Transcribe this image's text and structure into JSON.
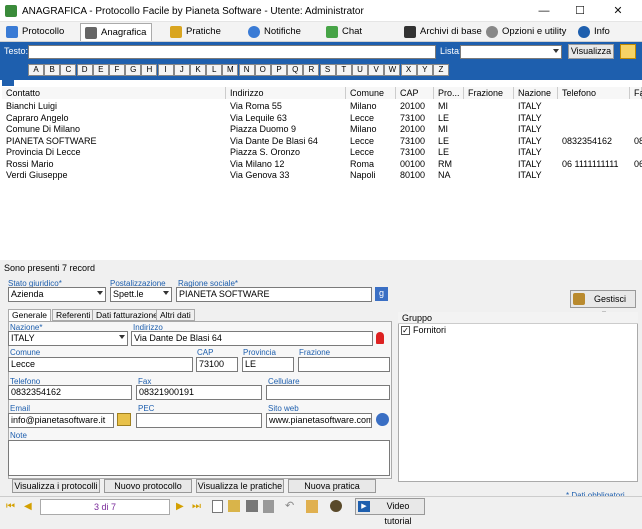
{
  "window": {
    "title": "ANAGRAFICA - Protocollo Facile by Pianeta Software - Utente: Administrator",
    "min": "—",
    "max": "☐",
    "close": "✕"
  },
  "tabs": [
    {
      "label": "Protocollo"
    },
    {
      "label": "Anagrafica"
    },
    {
      "label": "Pratiche"
    },
    {
      "label": "Notifiche"
    },
    {
      "label": "Chat"
    },
    {
      "label": "Archivi di base"
    },
    {
      "label": "Opzioni e utility"
    },
    {
      "label": "Info"
    }
  ],
  "search": {
    "testo_label": "Testo:",
    "testo_value": "",
    "lista_label": "Lista:",
    "lista_value": "",
    "visualizza_label": "Visualizza"
  },
  "letters": [
    "A",
    "B",
    "C",
    "D",
    "E",
    "F",
    "G",
    "H",
    "I",
    "J",
    "K",
    "L",
    "M",
    "N",
    "O",
    "P",
    "Q",
    "R",
    "S",
    "T",
    "U",
    "V",
    "W",
    "X",
    "Y",
    "Z"
  ],
  "grid": {
    "columns": [
      "Contatto",
      "Indirizzo",
      "Comune",
      "CAP",
      "Pro...",
      "Frazione",
      "Nazione",
      "Telefono",
      "Fa"
    ],
    "rows": [
      [
        "Bianchi Luigi",
        "Via Roma 55",
        "Milano",
        "20100",
        "MI",
        "",
        "ITALY",
        "",
        ""
      ],
      [
        "Capraro Angelo",
        "Via Lequile 63",
        "Lecce",
        "73100",
        "LE",
        "",
        "ITALY",
        "",
        ""
      ],
      [
        "Comune Di Milano",
        "Piazza Duomo 9",
        "Milano",
        "20100",
        "MI",
        "",
        "ITALY",
        "",
        ""
      ],
      [
        "PIANETA SOFTWARE",
        "Via Dante De Blasi 64",
        "Lecce",
        "73100",
        "LE",
        "",
        "ITALY",
        "0832354162",
        "08"
      ],
      [
        "Provincia Di Lecce",
        "Piazza S. Oronzo",
        "Lecce",
        "73100",
        "LE",
        "",
        "ITALY",
        "",
        ""
      ],
      [
        "Rossi Mario",
        "Via Milano 12",
        "Roma",
        "00100",
        "RM",
        "",
        "ITALY",
        "06 1111111111",
        "06"
      ],
      [
        "Verdi Giuseppe",
        "Via Genova 33",
        "Napoli",
        "80100",
        "NA",
        "",
        "ITALY",
        "",
        ""
      ]
    ],
    "record_count": "Sono presenti 7 record"
  },
  "form": {
    "stato_label": "Stato giuridico*",
    "stato_value": "Azienda",
    "post_label": "Postalizzazione",
    "post_value": "Spett.le",
    "ragione_label": "Ragione sociale*",
    "ragione_value": "PIANETA SOFTWARE",
    "gestisci_label": "Gestisci liste",
    "subtabs": [
      "Generale",
      "Referenti",
      "Dati fatturazione",
      "Altri dati"
    ],
    "nazione_label": "Nazione*",
    "nazione_value": "ITALY",
    "indirizzo_label": "Indirizzo",
    "indirizzo_value": "Via Dante De Blasi 64",
    "comune_label": "Comune",
    "comune_value": "Lecce",
    "cap_label": "CAP",
    "cap_value": "73100",
    "provincia_label": "Provincia",
    "provincia_value": "LE",
    "frazione_label": "Frazione",
    "frazione_value": "",
    "telefono_label": "Telefono",
    "telefono_value": "0832354162",
    "fax_label": "Fax",
    "fax_value": "08321900191",
    "cellulare_label": "Cellulare",
    "cellulare_value": "",
    "email_label": "Email",
    "email_value": "info@pianetasoftware.it",
    "pec_label": "PEC",
    "pec_value": "",
    "sito_label": "Sito web",
    "sito_value": "www.pianetasoftware.com",
    "note_label": "Note",
    "note_value": "",
    "gruppo_label": "Gruppo",
    "gruppo_item": "Fornitori"
  },
  "actions": [
    "Visualizza i protocolli",
    "Nuovo protocollo",
    "Visualizza le pratiche",
    "Nuova pratica"
  ],
  "dati_obbligatori": "* Dati obbligatori",
  "nav": {
    "position": "3 di 7",
    "video_label": "Video tutorial"
  }
}
